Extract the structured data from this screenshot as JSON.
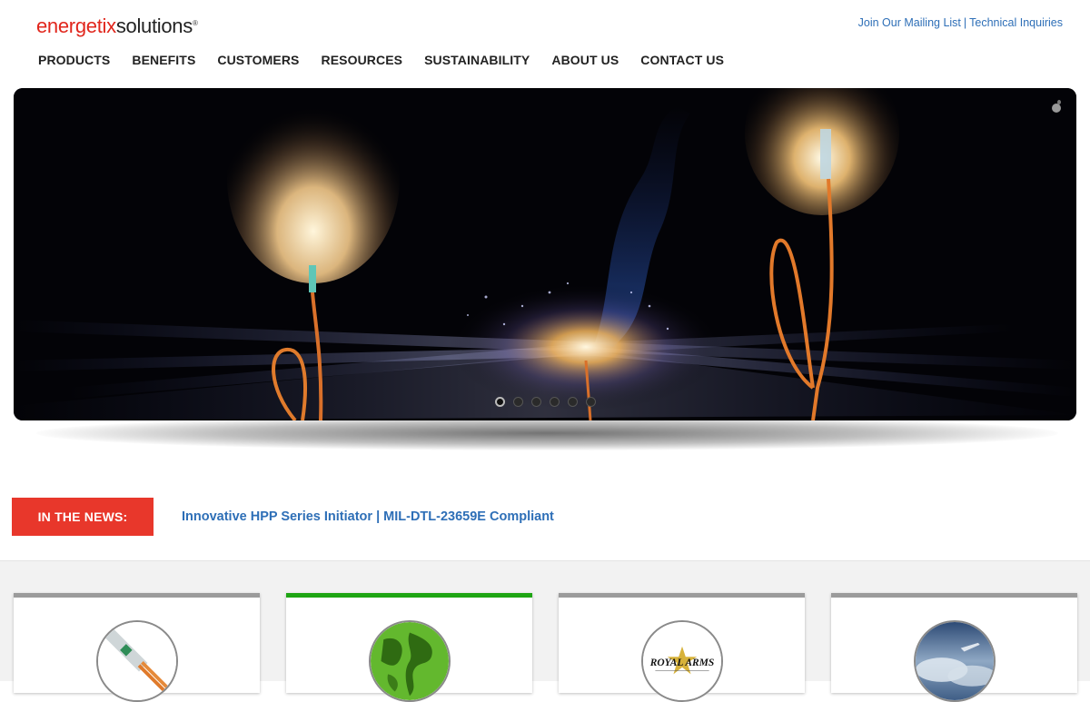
{
  "brand": {
    "logo_part1": "energetix",
    "logo_part2": "solutions",
    "logo_mark": "®"
  },
  "top_links": {
    "mailing": "Join Our Mailing List",
    "separator": "|",
    "inquiries": "Technical Inquiries"
  },
  "nav": [
    {
      "label": "PRODUCTS"
    },
    {
      "label": "BENEFITS"
    },
    {
      "label": "CUSTOMERS"
    },
    {
      "label": "RESOURCES"
    },
    {
      "label": "SUSTAINABILITY"
    },
    {
      "label": "ABOUT US"
    },
    {
      "label": "CONTACT US"
    }
  ],
  "hero": {
    "slide_count": 6,
    "active_slide": 1,
    "icons": {
      "pause": "pause-icon"
    }
  },
  "news": {
    "label": "IN THE NEWS:",
    "headline": "Innovative HPP Series Initiator | MIL-DTL-23659E Compliant"
  },
  "cards": [
    {
      "icon": "initiator-product-icon"
    },
    {
      "icon": "globe-icon"
    },
    {
      "icon": "royal-arms-logo",
      "logo_text": "ROYAL ARMS"
    },
    {
      "icon": "aircraft-sky-icon"
    }
  ],
  "colors": {
    "accent_red": "#e8372b",
    "link_blue": "#2e6fb7",
    "card_green": "#1ea513",
    "card_gray": "#9b9b9b"
  }
}
